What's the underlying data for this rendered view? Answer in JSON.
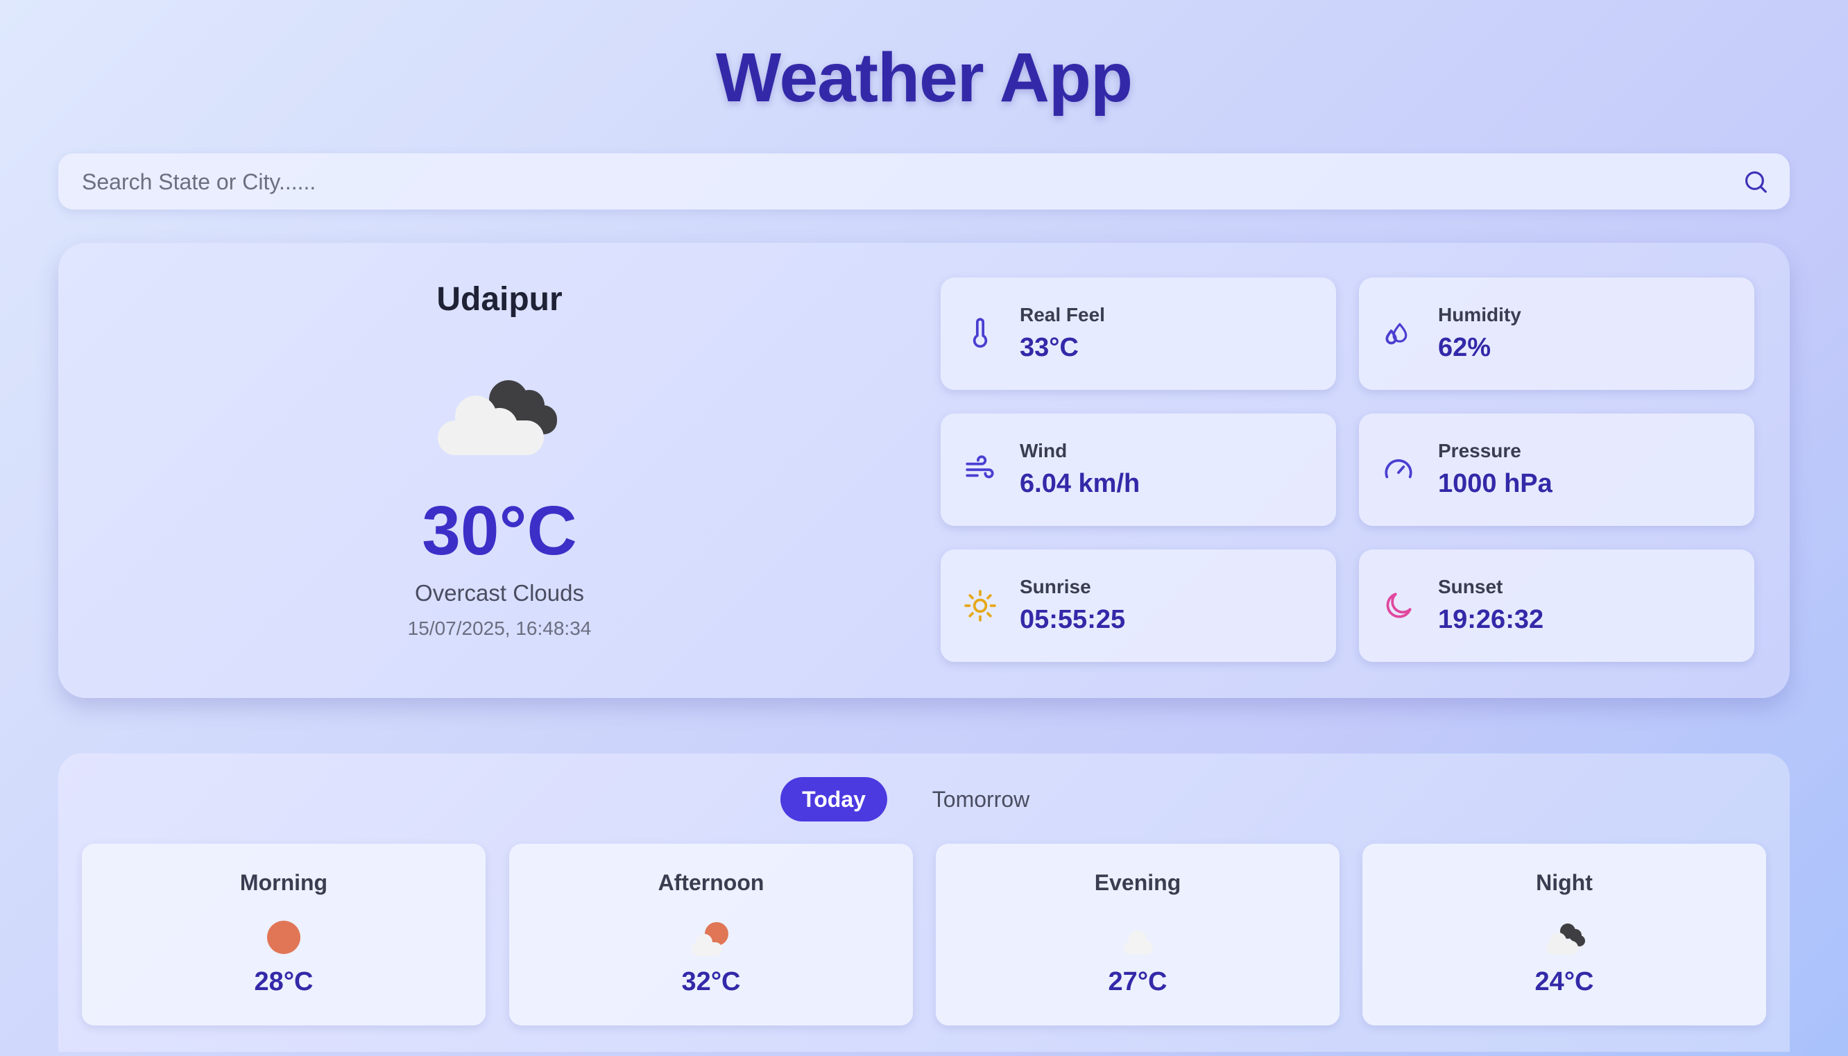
{
  "app": {
    "title": "Weather App"
  },
  "search": {
    "placeholder": "Search State or City......"
  },
  "current": {
    "city": "Udaipur",
    "temperature": "30°C",
    "description": "Overcast Clouds",
    "datetime": "15/07/2025, 16:48:34",
    "icon": "overcast-clouds-icon"
  },
  "stats": {
    "real_feel": {
      "label": "Real Feel",
      "value": "33°C",
      "icon": "thermometer-icon"
    },
    "humidity": {
      "label": "Humidity",
      "value": "62%",
      "icon": "droplets-icon"
    },
    "wind": {
      "label": "Wind",
      "value": "6.04 km/h",
      "icon": "wind-icon"
    },
    "pressure": {
      "label": "Pressure",
      "value": "1000 hPa",
      "icon": "gauge-icon"
    },
    "sunrise": {
      "label": "Sunrise",
      "value": "05:55:25",
      "icon": "sun-icon"
    },
    "sunset": {
      "label": "Sunset",
      "value": "19:26:32",
      "icon": "moon-icon"
    }
  },
  "forecast": {
    "tabs": {
      "today": "Today",
      "tomorrow": "Tomorrow",
      "active": "Today"
    },
    "periods": [
      {
        "name": "Morning",
        "temp": "28°C",
        "icon": "clear-sun-icon"
      },
      {
        "name": "Afternoon",
        "temp": "32°C",
        "icon": "partly-cloudy-icon"
      },
      {
        "name": "Evening",
        "temp": "27°C",
        "icon": "cloud-icon"
      },
      {
        "name": "Night",
        "temp": "24°C",
        "icon": "broken-clouds-icon"
      }
    ]
  },
  "colors": {
    "accent": "#3329a8",
    "active_tab": "#4b3ae0",
    "sun": "#e5a81a",
    "moon": "#e0479e",
    "icon_stroke": "#4a3fd0"
  }
}
